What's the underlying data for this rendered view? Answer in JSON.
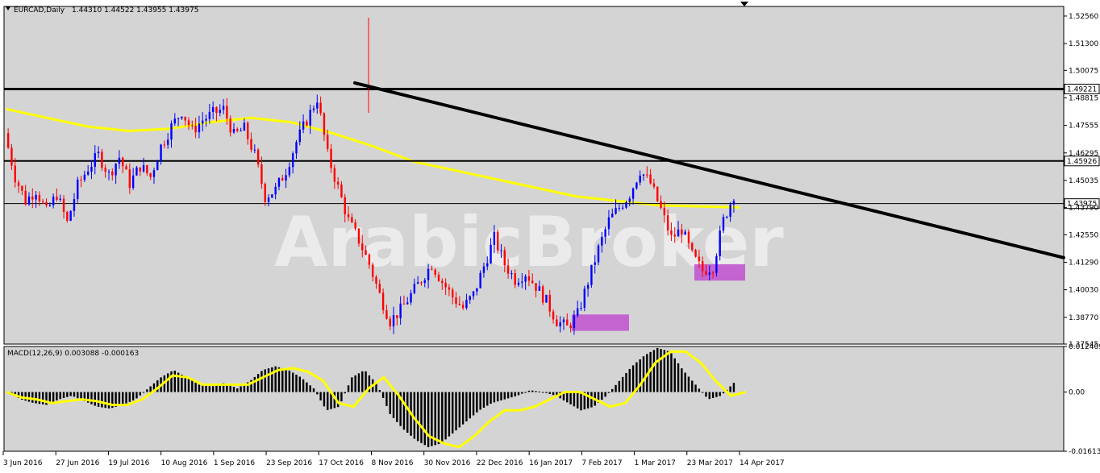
{
  "header": {
    "symbol_label": "EURCAD,Daily",
    "ohlc_label": "1.44310 1.44522 1.43955 1.43975"
  },
  "watermark": "ArabicBroker",
  "indicator": {
    "label": "MACD(12,26,9) 0.003088 -0.000163"
  },
  "colors": {
    "background": "#d4d4d4",
    "bull_candle": "#0000ff",
    "bear_candle": "#ff0000",
    "ma_line": "#ffff00",
    "trendline": "#000000",
    "highlight_box": "#c050d0",
    "macd_hist": "#000000",
    "macd_signal": "#ffff00"
  },
  "chart_data": [
    {
      "type": "candlestick",
      "title": "EURCAD,Daily",
      "ylim": [
        1.37545,
        1.53
      ],
      "y_ticks": [
        "1.52560",
        "1.51300",
        "1.50075",
        "1.48815",
        "1.47555",
        "1.46295",
        "1.45035",
        "1.43790",
        "1.42550",
        "1.41290",
        "1.40030",
        "1.38770",
        "1.37545"
      ],
      "x_ticks": [
        "3 Jun 2016",
        "27 Jun 2016",
        "19 Jul 2016",
        "10 Aug 2016",
        "1 Sep 2016",
        "23 Sep 2016",
        "17 Oct 2016",
        "8 Nov 2016",
        "30 Nov 2016",
        "22 Dec 2016",
        "16 Jan 2017",
        "7 Feb 2017",
        "1 Mar 2017",
        "23 Mar 2017",
        "14 Apr 2017"
      ],
      "horizontal_lines": [
        {
          "price": 1.49221,
          "label": "1.49221",
          "weight": "thick"
        },
        {
          "price": 1.45926,
          "label": "1.45926",
          "weight": "medium"
        },
        {
          "price": 1.43975,
          "label": "1.43975",
          "weight": "thin"
        }
      ],
      "trendline": {
        "from_date": "2 Nov 2016",
        "from_price": 1.495,
        "to_price_at_right_edge": 1.415
      },
      "ma_path": [
        1.483,
        1.479,
        1.475,
        1.473,
        1.474,
        1.477,
        1.479,
        1.477,
        1.472,
        1.466,
        1.459,
        1.455,
        1.451,
        1.447,
        1.443,
        1.441,
        1.439,
        1.4385,
        1.438
      ],
      "highlight_zones": [
        {
          "label": "",
          "from": "7 Feb 2017",
          "price_top": 1.389,
          "price_bottom": 1.3815
        },
        {
          "label": "",
          "from": "10 Apr 2017",
          "price_top": 1.412,
          "price_bottom": 1.4045
        }
      ],
      "close_path": [
        1.472,
        1.452,
        1.441,
        1.446,
        1.436,
        1.444,
        1.431,
        1.448,
        1.456,
        1.462,
        1.453,
        1.461,
        1.449,
        1.457,
        1.452,
        1.466,
        1.475,
        1.482,
        1.473,
        1.478,
        1.481,
        1.483,
        1.471,
        1.474,
        1.462,
        1.443,
        1.446,
        1.455,
        1.468,
        1.478,
        1.488,
        1.462,
        1.447,
        1.432,
        1.423,
        1.412,
        1.398,
        1.386,
        1.391,
        1.398,
        1.405,
        1.412,
        1.404,
        1.397,
        1.392,
        1.398,
        1.411,
        1.424,
        1.412,
        1.405,
        1.408,
        1.402,
        1.395,
        1.386,
        1.383,
        1.389,
        1.404,
        1.419,
        1.432,
        1.438,
        1.444,
        1.455,
        1.449,
        1.437,
        1.424,
        1.428,
        1.416,
        1.409,
        1.411,
        1.432,
        1.444
      ]
    },
    {
      "type": "bar",
      "title": "MACD(12,26,9) 0.003088 -0.000163",
      "ylim": [
        -0.016135,
        0.012409
      ],
      "y_ticks": [
        "0.012409",
        "0.00",
        "-0.016135"
      ],
      "histogram": [
        0.0,
        -0.002,
        -0.003,
        -0.0035,
        -0.002,
        -0.001,
        -0.0025,
        -0.004,
        -0.0045,
        -0.0035,
        -0.002,
        0.001,
        0.004,
        0.006,
        0.004,
        0.002,
        0.0015,
        0.0025,
        0.001,
        0.003,
        0.006,
        0.007,
        0.006,
        0.004,
        0.001,
        -0.005,
        -0.004,
        0.004,
        0.006,
        0.002,
        -0.006,
        -0.01,
        -0.013,
        -0.015,
        -0.014,
        -0.011,
        -0.008,
        -0.005,
        -0.003,
        -0.002,
        -0.001,
        0.0005,
        0.0,
        -0.001,
        -0.003,
        -0.005,
        -0.004,
        -0.001,
        0.003,
        0.007,
        0.01,
        0.012,
        0.011,
        0.006,
        0.002,
        -0.002,
        -0.001,
        0.0025
      ],
      "signal": [
        0.0,
        -0.0015,
        -0.002,
        -0.003,
        -0.0025,
        -0.002,
        -0.0025,
        -0.0035,
        -0.0035,
        -0.002,
        0.001,
        0.0045,
        0.004,
        0.002,
        0.002,
        0.002,
        0.002,
        0.004,
        0.006,
        0.0065,
        0.0055,
        0.003,
        -0.003,
        -0.004,
        0.001,
        0.004,
        -0.001,
        -0.007,
        -0.012,
        -0.014,
        -0.015,
        -0.012,
        -0.008,
        -0.005,
        -0.005,
        -0.004,
        -0.002,
        0.0,
        0.0,
        -0.002,
        -0.004,
        -0.003,
        0.002,
        0.008,
        0.011,
        0.011,
        0.008,
        0.003,
        -0.001,
        0.0
      ]
    }
  ]
}
